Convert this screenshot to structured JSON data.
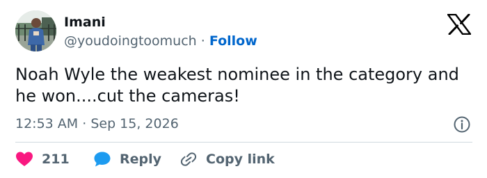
{
  "author": {
    "name": "Imani",
    "handle": "@youdoingtoomuch",
    "separator": "·",
    "follow_label": "Follow"
  },
  "tweet": {
    "text": "Noah Wyle the weakest nominee in the category and he won....cut the cameras!",
    "time": "12:53 AM",
    "meta_separator": "·",
    "date": "Sep 15, 2026"
  },
  "actions": {
    "like_count": "211",
    "reply_label": "Reply",
    "copy_label": "Copy link"
  },
  "icons": {
    "logo": "x-logo-icon",
    "info": "info-icon",
    "like": "heart-icon",
    "reply": "speech-bubble-icon",
    "copy": "link-icon"
  },
  "colors": {
    "accent": "#0066cc",
    "like": "#f91880",
    "muted": "#536471",
    "text": "#0f1419"
  }
}
